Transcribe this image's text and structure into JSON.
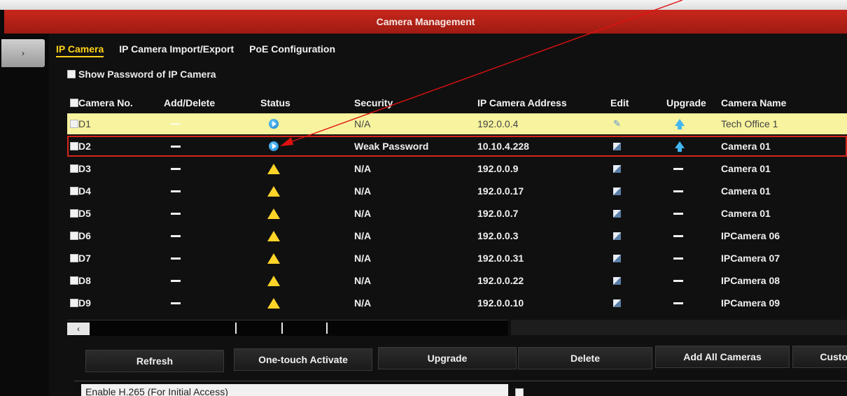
{
  "window": {
    "title": "Camera Management",
    "collapse_glyph": "›"
  },
  "tabs": [
    {
      "label": "IP Camera",
      "active": true
    },
    {
      "label": "IP Camera Import/Export",
      "active": false
    },
    {
      "label": "PoE Configuration",
      "active": false
    }
  ],
  "show_password": {
    "label": "Show Password of IP Camera",
    "checked": false
  },
  "table": {
    "headers": {
      "camera_no": "Camera No.",
      "add_delete": "Add/Delete",
      "status": "Status",
      "security": "Security",
      "ip": "IP Camera Address",
      "edit": "Edit",
      "upgrade": "Upgrade",
      "name": "Camera Name"
    },
    "rows": [
      {
        "no": "D1",
        "add": "dash",
        "status": "online-icon",
        "security": "N/A",
        "ip": "192.0.0.4",
        "edit": "pencil-icon",
        "upgrade": "upgrade-icon",
        "name": "Tech Office 1"
      },
      {
        "no": "D2",
        "add": "dash",
        "status": "online-icon",
        "security": "Weak Password",
        "ip": "10.10.4.228",
        "edit": "edit-icon",
        "upgrade": "upgrade-icon",
        "name": "Camera 01"
      },
      {
        "no": "D3",
        "add": "dash",
        "status": "warning-icon",
        "security": "N/A",
        "ip": "192.0.0.9",
        "edit": "edit-icon",
        "upgrade": "dash",
        "name": "Camera 01"
      },
      {
        "no": "D4",
        "add": "dash",
        "status": "warning-icon",
        "security": "N/A",
        "ip": "192.0.0.17",
        "edit": "edit-icon",
        "upgrade": "dash",
        "name": "Camera 01"
      },
      {
        "no": "D5",
        "add": "dash",
        "status": "warning-icon",
        "security": "N/A",
        "ip": "192.0.0.7",
        "edit": "edit-icon",
        "upgrade": "dash",
        "name": "Camera 01"
      },
      {
        "no": "D6",
        "add": "dash",
        "status": "warning-icon",
        "security": "N/A",
        "ip": "192.0.0.3",
        "edit": "edit-icon",
        "upgrade": "dash",
        "name": "IPCamera 06"
      },
      {
        "no": "D7",
        "add": "dash",
        "status": "warning-icon",
        "security": "N/A",
        "ip": "192.0.0.31",
        "edit": "edit-icon",
        "upgrade": "dash",
        "name": "IPCamera 07"
      },
      {
        "no": "D8",
        "add": "dash",
        "status": "warning-icon",
        "security": "N/A",
        "ip": "192.0.0.22",
        "edit": "edit-icon",
        "upgrade": "dash",
        "name": "IPCamera 08"
      },
      {
        "no": "D9",
        "add": "dash",
        "status": "warning-icon",
        "security": "N/A",
        "ip": "192.0.0.10",
        "edit": "edit-icon",
        "upgrade": "dash",
        "name": "IPCamera 09"
      }
    ]
  },
  "scroll_left_glyph": "‹",
  "buttons": {
    "refresh": "Refresh",
    "activate": "One-touch Activate",
    "upgrade": "Upgrade",
    "delete": "Delete",
    "add_all": "Add All Cameras",
    "custom": "Custo"
  },
  "h265": {
    "label": "Enable H.265 (For Initial Access)",
    "checked": false
  },
  "colors": {
    "title_bar": "#b8231a",
    "active_tab": "#ffd21a",
    "highlight_row": "#f7f39e",
    "selection_outline": "#d4261b",
    "annotation_arrow": "#e01010"
  }
}
